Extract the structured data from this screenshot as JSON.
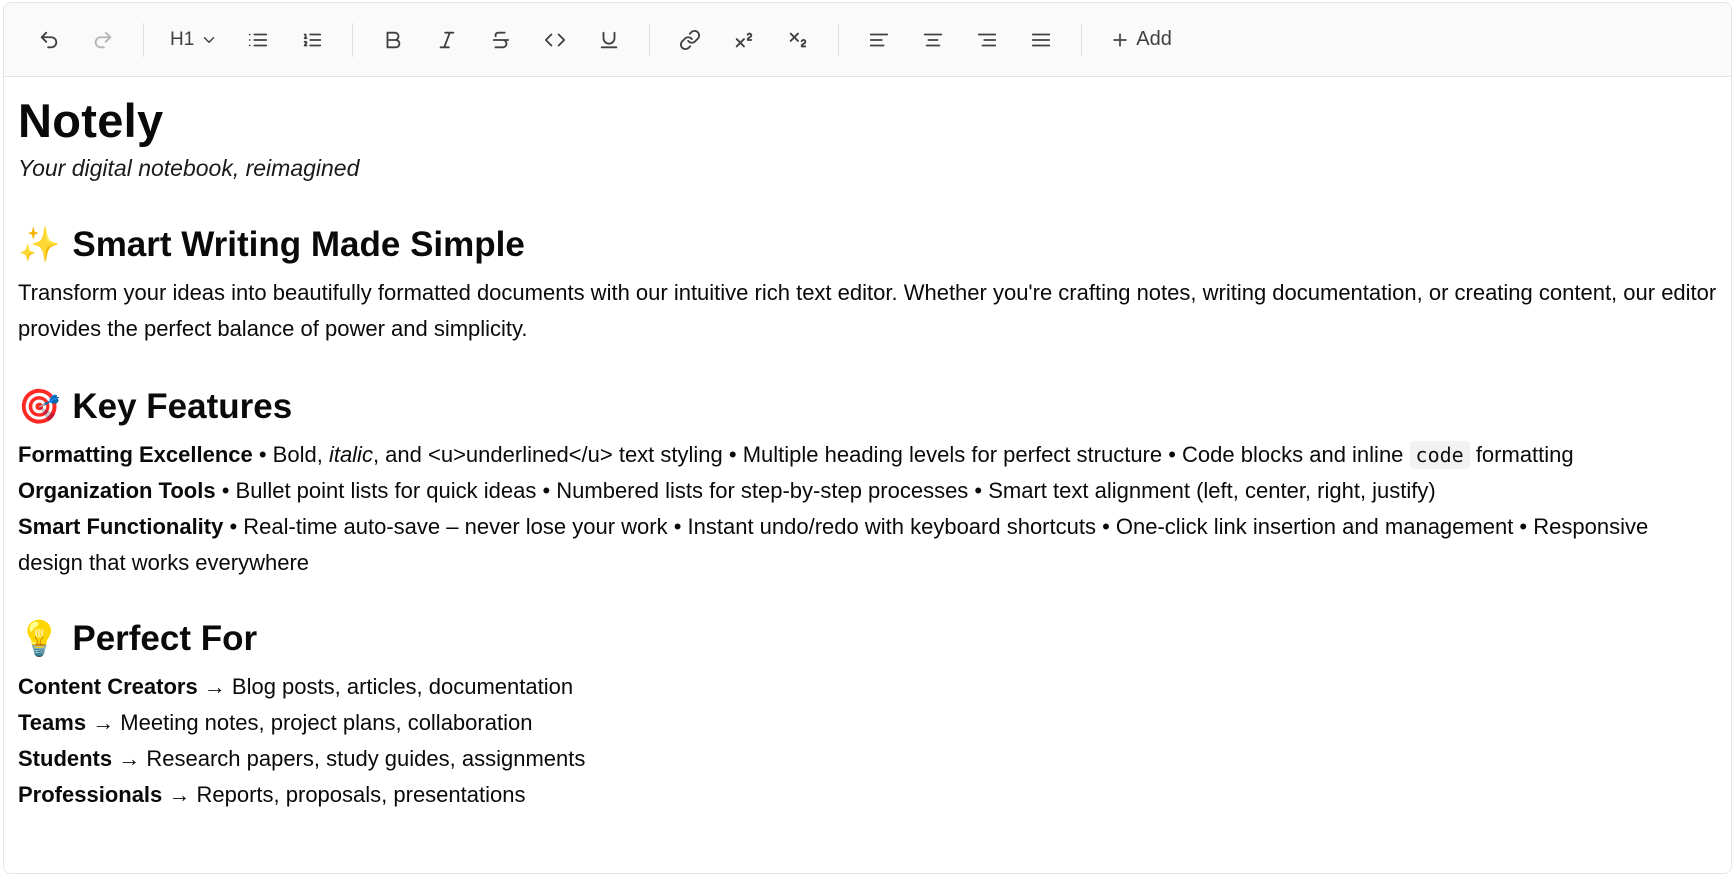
{
  "toolbar": {
    "undo": "undo-icon",
    "redo": "redo-icon",
    "heading_value": "H1",
    "add_label": "Add"
  },
  "doc": {
    "title": "Notely",
    "subtitle": "Your digital notebook, reimagined",
    "section1": {
      "emoji": "✨",
      "heading": "Smart Writing Made Simple",
      "body": "Transform your ideas into beautifully formatted documents with our intuitive rich text editor. Whether you're crafting notes, writing documentation, or creating content, our editor provides the perfect balance of power and simplicity."
    },
    "section2": {
      "emoji": "🎯",
      "heading": "Key Features",
      "f1_label": "Formatting Excellence",
      "f1_a": " • Bold, ",
      "f1_italic": "italic",
      "f1_b": ", and <u>underlined</u> text styling • Multiple heading levels for perfect structure • Code blocks and inline ",
      "f1_code": "code",
      "f1_c": " formatting",
      "f2_label": "Organization Tools",
      "f2_text": " • Bullet point lists for quick ideas • Numbered lists for step-by-step processes • Smart text alignment (left, center, right, justify)",
      "f3_label": "Smart Functionality",
      "f3_text": " • Real-time auto-save – never lose your work • Instant undo/redo with keyboard shortcuts • One-click link insertion and management • Responsive design that works everywhere"
    },
    "section3": {
      "emoji": "💡",
      "heading": "Perfect For",
      "items": [
        {
          "label": "Content Creators",
          "text": " → Blog posts, articles, documentation"
        },
        {
          "label": "Teams",
          "text": " → Meeting notes, project plans, collaboration"
        },
        {
          "label": "Students",
          "text": " → Research papers, study guides, assignments"
        },
        {
          "label": "Professionals",
          "text": " → Reports, proposals, presentations"
        }
      ]
    }
  },
  "colors": {
    "toolbar_bg": "#fafafa",
    "border": "#e5e5e5",
    "icon": "#404040",
    "icon_disabled": "#b5b5b5",
    "text": "#0a0a0a"
  }
}
